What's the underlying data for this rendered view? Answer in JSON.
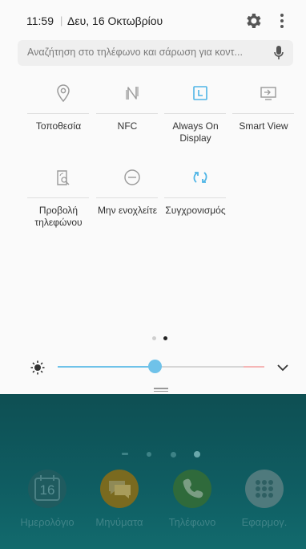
{
  "status_bar": {
    "time": "11:59",
    "separator": "|",
    "date": "Δευ, 16 Οκτωβρίου"
  },
  "search": {
    "placeholder": "Αναζήτηση στο τηλέφωνο και σάρωση για κοντ..."
  },
  "quick_tiles": [
    {
      "label": "Τοποθεσία",
      "icon": "location-pin-icon",
      "active": false
    },
    {
      "label": "NFC",
      "icon": "nfc-icon",
      "active": false
    },
    {
      "label": "Always On Display",
      "icon": "always-on-display-icon",
      "active": true
    },
    {
      "label": "Smart View",
      "icon": "smart-view-icon",
      "active": false
    },
    {
      "label": "Προβολή τηλεφώνου",
      "icon": "phone-view-icon",
      "active": false
    },
    {
      "label": "Μην ενοχλείτε",
      "icon": "do-not-disturb-icon",
      "active": false
    },
    {
      "label": "Συγχρονισμός",
      "icon": "sync-icon",
      "active": true
    }
  ],
  "page_indicator": {
    "pages": 2,
    "current": 2
  },
  "brightness": {
    "level": 0.47
  },
  "home_screen": {
    "dock": [
      {
        "label": "Ημερολόγιο",
        "icon": "calendar-icon",
        "badge_text": "16"
      },
      {
        "label": "Μηνύματα",
        "icon": "messages-icon"
      },
      {
        "label": "Τηλέφωνο",
        "icon": "phone-icon"
      },
      {
        "label": "Εφαρμογ.",
        "icon": "apps-grid-icon"
      }
    ]
  },
  "colors": {
    "accent": "#4fb5e6",
    "inactive_icon": "#9a9a9a",
    "panel_bg": "#fafafa",
    "home_bg": "#0f5d62"
  }
}
